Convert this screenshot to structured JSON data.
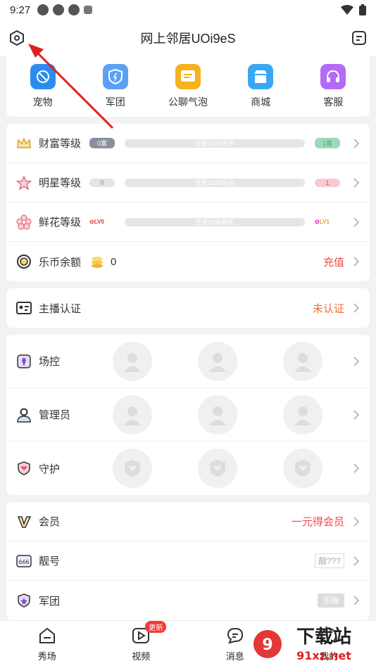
{
  "status": {
    "time": "9:27"
  },
  "header": {
    "title": "网上邻居UOi9eS"
  },
  "quick": [
    {
      "label": "宠物",
      "icon": "pet-icon",
      "color": "#2a8cf0"
    },
    {
      "label": "军团",
      "icon": "legion-shield-icon",
      "color": "#5aa0f5"
    },
    {
      "label": "公聊气泡",
      "icon": "chat-bubble-icon",
      "color": "#f7b21e"
    },
    {
      "label": "商城",
      "icon": "shop-icon",
      "color": "#3aa7f5"
    },
    {
      "label": "客服",
      "icon": "headset-icon",
      "color": "#b46af5"
    }
  ],
  "levels": [
    {
      "label": "财富等级",
      "left_badge": "0富",
      "progress_text": "还差1000乐币",
      "right_badge": "1富",
      "progress": 0
    },
    {
      "label": "明星等级",
      "left_badge": "0",
      "progress_text": "还差1000乐钻",
      "right_badge": "1",
      "progress": 0
    },
    {
      "label": "鲜花等级",
      "left_badge": "LV0",
      "progress_text": "还差10朵鲜花",
      "right_badge": "LV1",
      "progress": 0
    }
  ],
  "balance": {
    "label": "乐币余额",
    "value": "0",
    "action": "充值"
  },
  "anchor": {
    "label": "主播认证",
    "status": "未认证"
  },
  "roles": [
    {
      "label": "场控"
    },
    {
      "label": "管理员"
    },
    {
      "label": "守护"
    }
  ],
  "member": {
    "label": "会员",
    "action": "一元得会员"
  },
  "pretty_number": {
    "label": "靓号",
    "value": "靓???"
  },
  "legion_row": {
    "label": "军团",
    "tag": "乐嗨"
  },
  "nav": [
    {
      "label": "秀场",
      "icon": "home-show-icon"
    },
    {
      "label": "视频",
      "icon": "video-play-icon",
      "badge": "更新"
    },
    {
      "label": "消息",
      "icon": "message-icon"
    },
    {
      "label": "我的",
      "icon": "profile-icon"
    }
  ],
  "watermark": {
    "text": "下载站",
    "sub": "91xz.net"
  }
}
